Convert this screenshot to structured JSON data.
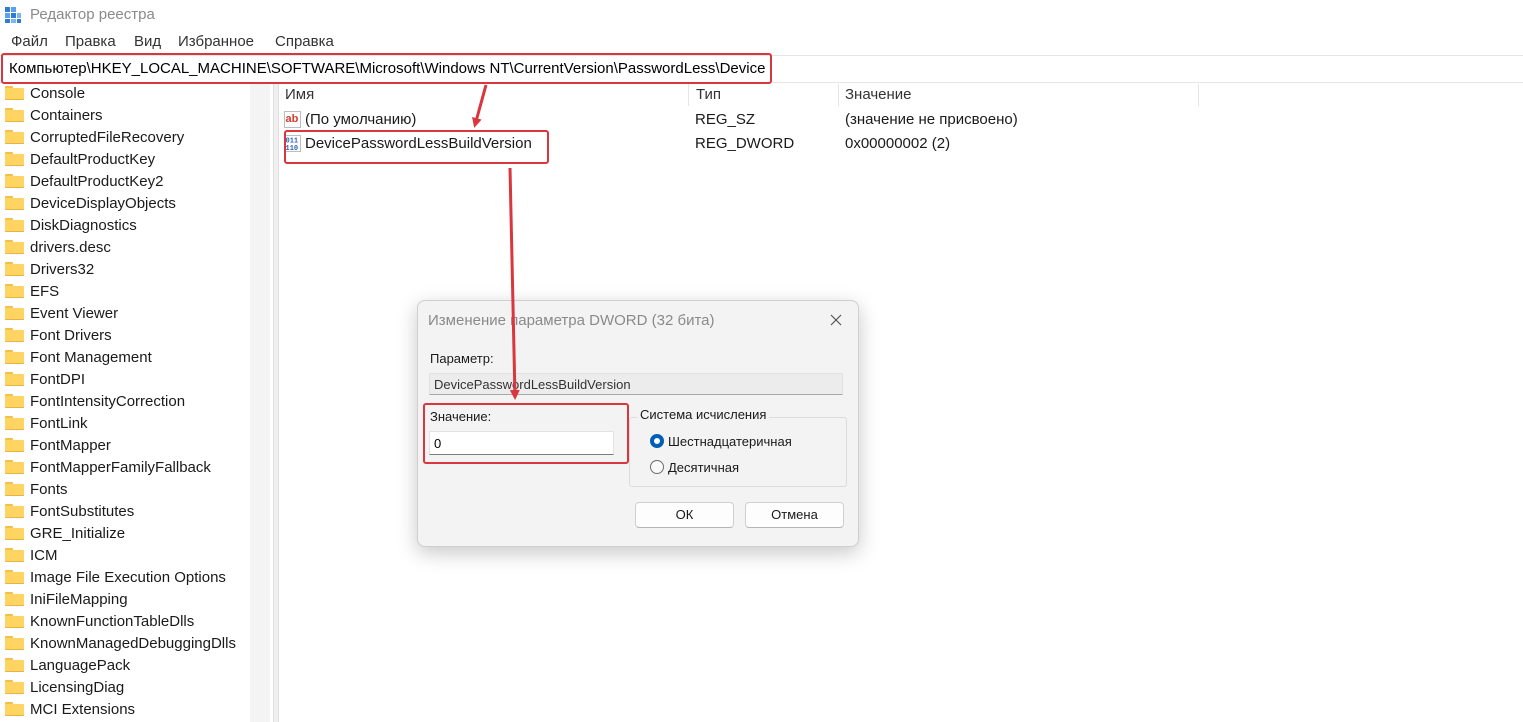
{
  "window": {
    "title": "Редактор реестра"
  },
  "menu": [
    "Файл",
    "Правка",
    "Вид",
    "Избранное",
    "Справка"
  ],
  "address": "Компьютер\\HKEY_LOCAL_MACHINE\\SOFTWARE\\Microsoft\\Windows NT\\CurrentVersion\\PasswordLess\\Device",
  "tree": [
    "Console",
    "Containers",
    "CorruptedFileRecovery",
    "DefaultProductKey",
    "DefaultProductKey2",
    "DeviceDisplayObjects",
    "DiskDiagnostics",
    "drivers.desc",
    "Drivers32",
    "EFS",
    "Event Viewer",
    "Font Drivers",
    "Font Management",
    "FontDPI",
    "FontIntensityCorrection",
    "FontLink",
    "FontMapper",
    "FontMapperFamilyFallback",
    "Fonts",
    "FontSubstitutes",
    "GRE_Initialize",
    "ICM",
    "Image File Execution Options",
    "IniFileMapping",
    "KnownFunctionTableDlls",
    "KnownManagedDebuggingDlls",
    "LanguagePack",
    "LicensingDiag",
    "MCI Extensions"
  ],
  "list": {
    "columns": {
      "name": "Имя",
      "type": "Тип",
      "value": "Значение"
    },
    "rows": [
      {
        "icon": "string-value-icon",
        "name": "(По умолчанию)",
        "type": "REG_SZ",
        "value": "(значение не присвоено)"
      },
      {
        "icon": "binary-value-icon",
        "name": "DevicePasswordLessBuildVersion",
        "type": "REG_DWORD",
        "value": "0x00000002 (2)"
      }
    ]
  },
  "dialog": {
    "title": "Изменение параметра DWORD (32 бита)",
    "param_label": "Параметр:",
    "param_value": "DevicePasswordLessBuildVersion",
    "value_label": "Значение:",
    "value": "0",
    "base_group": "Система исчисления",
    "base_options": [
      {
        "label": "Шестнадцатеричная",
        "selected": true
      },
      {
        "label": "Десятичная",
        "selected": false
      }
    ],
    "ok": "ОК",
    "cancel": "Отмена"
  },
  "colors": {
    "highlight": "#d9363e",
    "folder": "#ffd462",
    "accent": "#005fb8"
  }
}
